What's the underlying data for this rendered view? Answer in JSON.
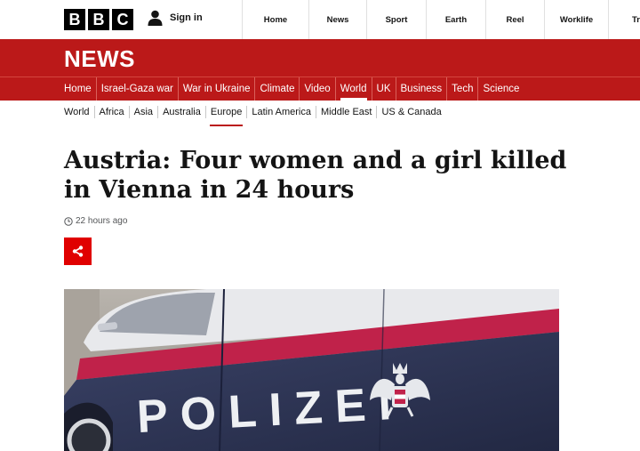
{
  "logo": {
    "letters": [
      "B",
      "B",
      "C"
    ]
  },
  "account": {
    "signin_label": "Sign in"
  },
  "topnav": {
    "items": [
      {
        "label": "Home"
      },
      {
        "label": "News"
      },
      {
        "label": "Sport"
      },
      {
        "label": "Earth"
      },
      {
        "label": "Reel"
      },
      {
        "label": "Worklife"
      },
      {
        "label": "Trave"
      }
    ]
  },
  "brand": {
    "section_title": "NEWS"
  },
  "sections": {
    "items": [
      {
        "label": "Home"
      },
      {
        "label": "Israel-Gaza war"
      },
      {
        "label": "War in Ukraine"
      },
      {
        "label": "Climate"
      },
      {
        "label": "Video"
      },
      {
        "label": "World"
      },
      {
        "label": "UK"
      },
      {
        "label": "Business"
      },
      {
        "label": "Tech"
      },
      {
        "label": "Science"
      }
    ],
    "active": "World"
  },
  "subsections": {
    "items": [
      {
        "label": "World"
      },
      {
        "label": "Africa"
      },
      {
        "label": "Asia"
      },
      {
        "label": "Australia"
      },
      {
        "label": "Europe"
      },
      {
        "label": "Latin America"
      },
      {
        "label": "Middle East"
      },
      {
        "label": "US & Canada"
      }
    ],
    "active": "Europe"
  },
  "article": {
    "headline": "Austria: Four women and a girl killed in Vienna in 24 hours",
    "timestamp": "22 hours ago",
    "image_text": "POLIZEI"
  },
  "colors": {
    "brand_red": "#bb1919",
    "share_red": "#e00000",
    "police_blue": "#2c3354",
    "police_stripe": "#c0224a"
  },
  "icons": {
    "user": "user-icon",
    "clock": "clock-icon",
    "share": "share-icon",
    "eagle": "austrian-eagle-emblem"
  }
}
